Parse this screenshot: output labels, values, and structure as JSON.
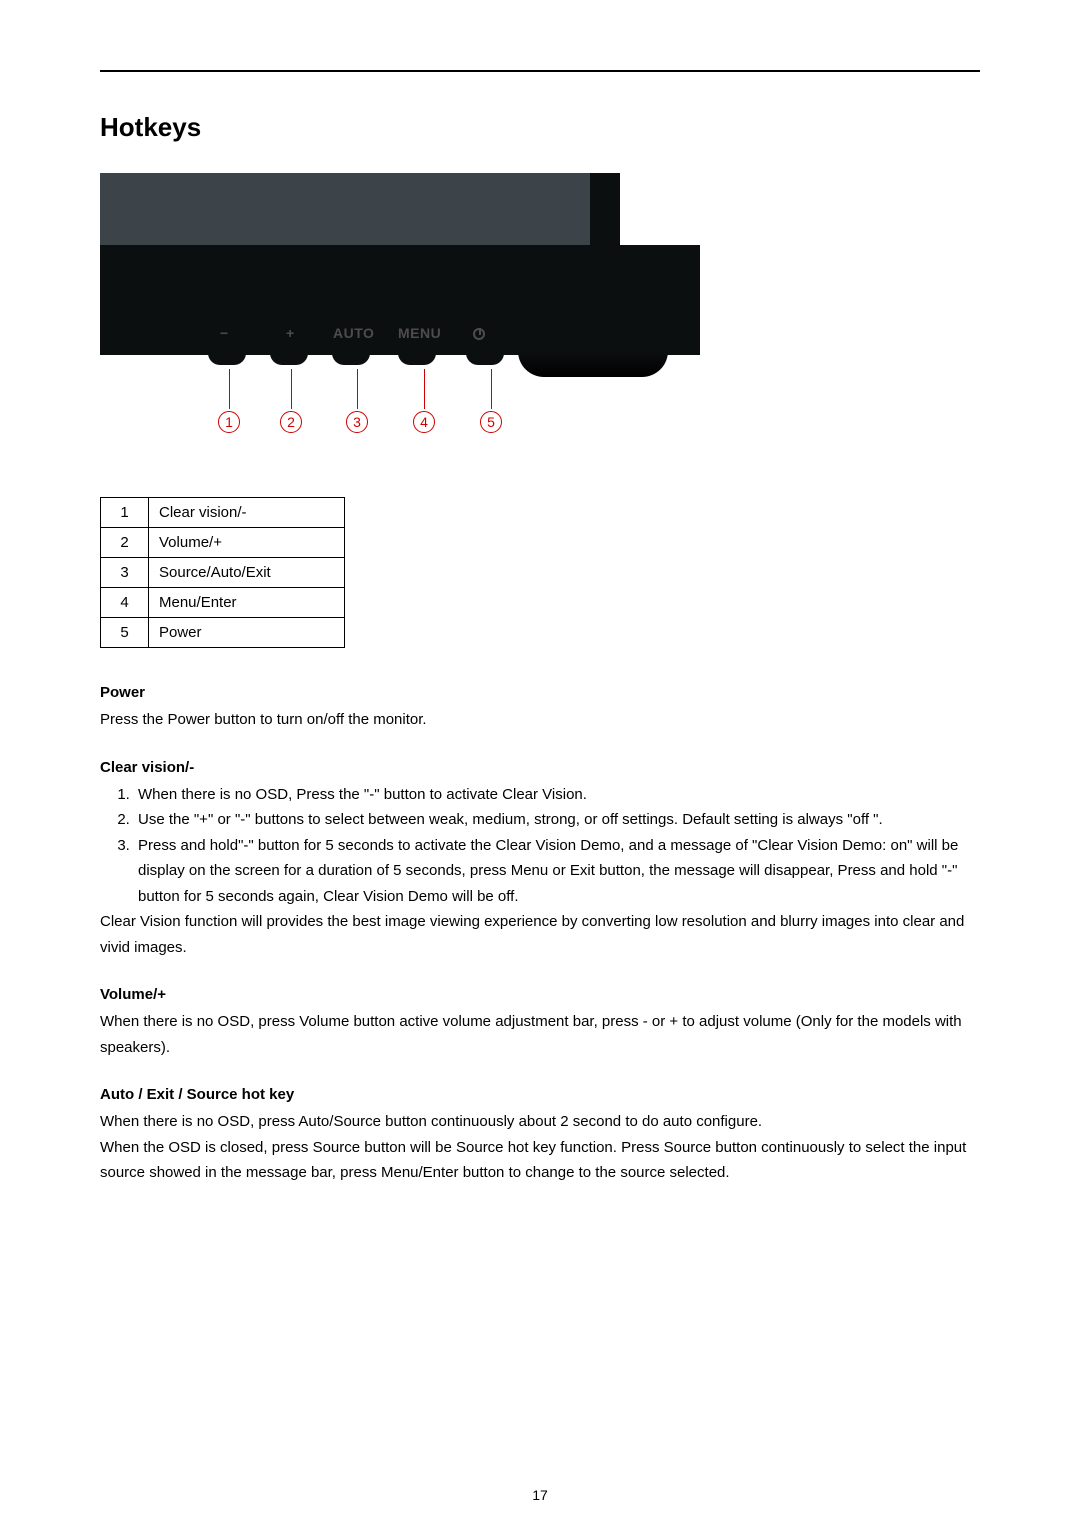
{
  "section_title": "Hotkeys",
  "diagram": {
    "buttons": {
      "minus_label": "−",
      "plus_label": "+",
      "auto_label": "AUTO",
      "menu_label": "MENU",
      "power_label": ""
    },
    "callouts": [
      "1",
      "2",
      "3",
      "4",
      "5"
    ]
  },
  "keys": [
    {
      "index": "1",
      "label": "Clear vision/-"
    },
    {
      "index": "2",
      "label": "Volume/+"
    },
    {
      "index": "3",
      "label": "Source/Auto/Exit"
    },
    {
      "index": "4",
      "label": "Menu/Enter"
    },
    {
      "index": "5",
      "label": "Power"
    }
  ],
  "power": {
    "heading": "Power",
    "text": "Press the Power button to turn on/off the monitor."
  },
  "clear_vision": {
    "heading": "Clear vision/-",
    "items": [
      "When there is no OSD, Press the \"-\" button to activate Clear Vision.",
      "Use the \"+\" or \"-\" buttons to select between weak, medium, strong, or off settings. Default setting is always \"off \".",
      "Press and hold\"-\" button for 5 seconds to activate the Clear Vision Demo, and a message of \"Clear Vision Demo: on\" will be display on the screen for a duration of 5 seconds, press Menu or Exit button, the message will disappear, Press and hold \"-\" button for 5 seconds again, Clear Vision Demo will be off."
    ],
    "footer": "Clear Vision function will provides the best image viewing experience by converting low resolution and blurry images into clear and vivid images."
  },
  "volume": {
    "heading": "Volume/+",
    "text": "When there is no OSD, press Volume button active volume adjustment  bar, press - or + to adjust volume (Only for the models with speakers)."
  },
  "auto_exit": {
    "heading": "Auto / Exit / Source hot key",
    "line1": "When there is no OSD, press Auto/Source button continuously about 2 second to do auto configure.",
    "line2": "When the OSD is closed, press Source button will be Source hot key function. Press Source button continuously to select the input source showed in the message bar, press Menu/Enter button to change to the source selected."
  },
  "page_number": "17"
}
